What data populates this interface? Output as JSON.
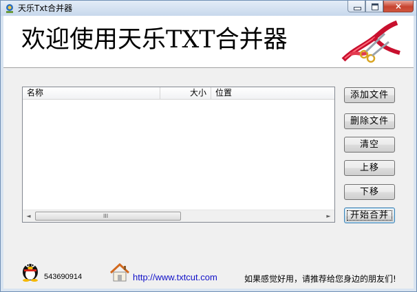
{
  "window": {
    "title": "天乐Txt合并器",
    "close_glyph": "×"
  },
  "banner": {
    "title": "欢迎使用天乐TXT合并器",
    "logo_icon": "ribbon-scissors-icon"
  },
  "file_list": {
    "columns": [
      "名称",
      "大小",
      "位置"
    ],
    "rows": [],
    "scroll_left_glyph": "◄",
    "scroll_right_glyph": "►",
    "thumb_grip": "III"
  },
  "buttons": {
    "add_files": "添加文件",
    "remove_files": "删除文件",
    "clear": "清空",
    "move_up": "上移",
    "move_down": "下移",
    "start_merge": "开始合并"
  },
  "footer": {
    "qq_icon": "qq-penguin-icon",
    "qq_number": "543690914",
    "home_icon": "house-icon",
    "website": "http://www.txtcut.com",
    "promo_text": "如果感觉好用，请推荐给您身边的朋友们!"
  },
  "colors": {
    "link": "#1010c8",
    "close_button": "#c7432f"
  }
}
